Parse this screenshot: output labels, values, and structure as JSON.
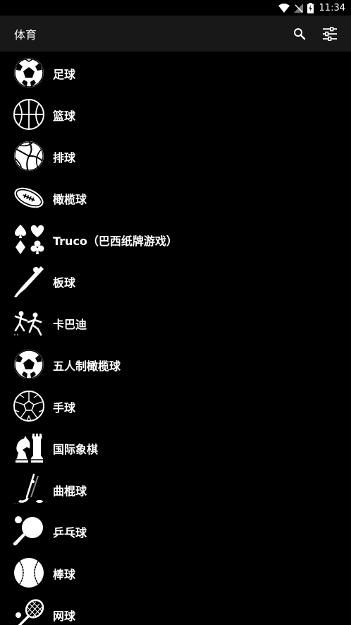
{
  "status_bar": {
    "time": "11:34"
  },
  "app_bar": {
    "title": "体育"
  },
  "sports": [
    {
      "label": "足球",
      "icon": "soccer-ball-icon"
    },
    {
      "label": "篮球",
      "icon": "basketball-icon"
    },
    {
      "label": "排球",
      "icon": "volleyball-icon"
    },
    {
      "label": "橄榄球",
      "icon": "rugby-ball-icon"
    },
    {
      "label": "Truco（巴西纸牌游戏）",
      "icon": "card-suits-icon"
    },
    {
      "label": "板球",
      "icon": "cricket-bat-icon"
    },
    {
      "label": "卡巴迪",
      "icon": "kabaddi-icon"
    },
    {
      "label": "五人制橄榄球",
      "icon": "futsal-ball-icon"
    },
    {
      "label": "手球",
      "icon": "handball-icon"
    },
    {
      "label": "国际象棋",
      "icon": "chess-icon"
    },
    {
      "label": "曲棍球",
      "icon": "hockey-stick-icon"
    },
    {
      "label": "乒乓球",
      "icon": "table-tennis-icon"
    },
    {
      "label": "棒球",
      "icon": "baseball-icon"
    },
    {
      "label": "网球",
      "icon": "tennis-racket-icon"
    }
  ]
}
